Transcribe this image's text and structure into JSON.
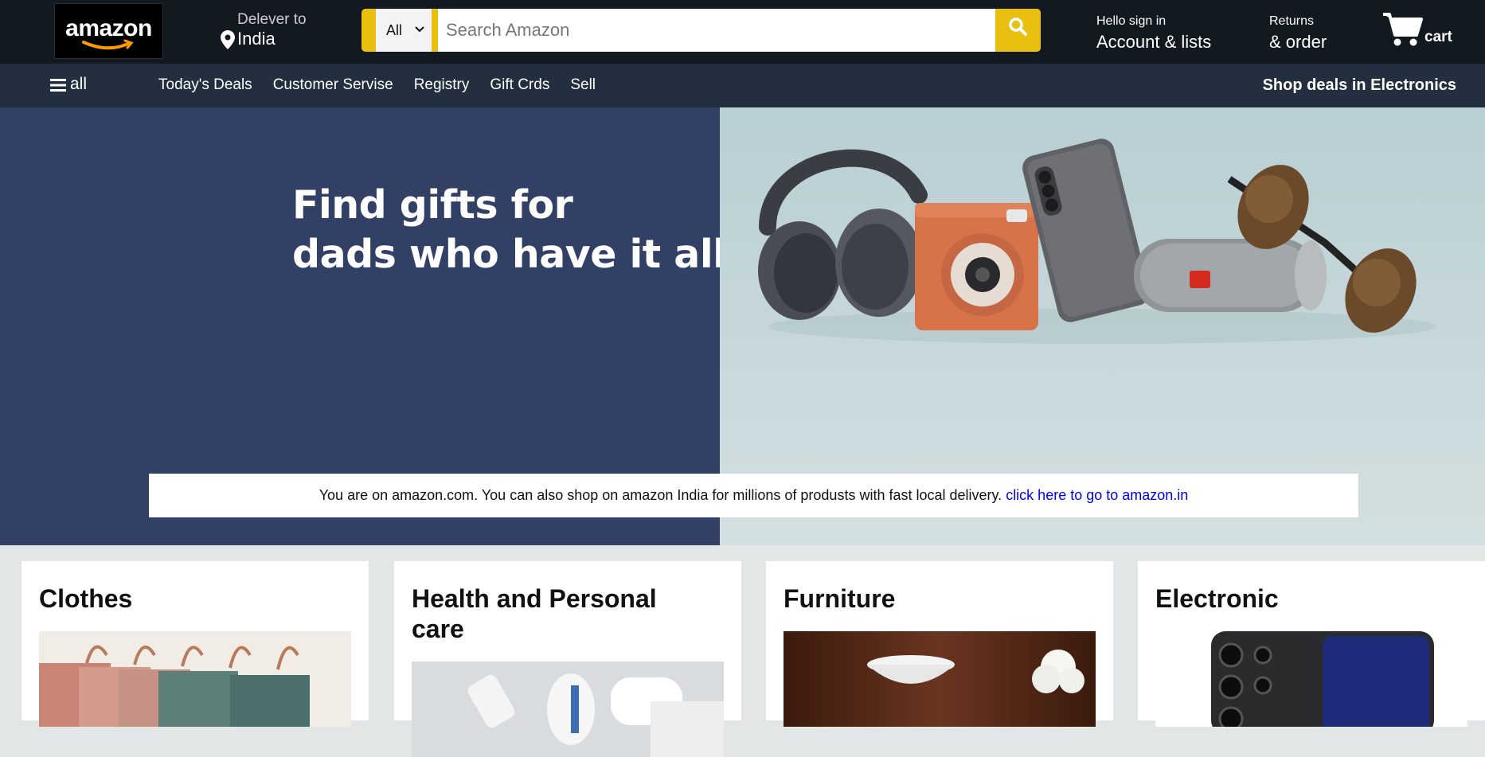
{
  "header": {
    "logo_text": "amazon",
    "deliver_label": "Delever to",
    "deliver_location": "India",
    "search": {
      "category": "All",
      "placeholder": "Search Amazon"
    },
    "account": {
      "line1": "Hello sign in",
      "line2": "Account & lists"
    },
    "returns": {
      "line1": "Returns",
      "line2": "& order"
    },
    "cart_label": "cart"
  },
  "subnav": {
    "all_label": "all",
    "links": [
      "Today's Deals",
      "Customer Servise",
      "Registry",
      "Gift Crds",
      "Sell"
    ],
    "promo": "Shop deals in Electronics"
  },
  "hero": {
    "title_line1": "Find gifts for",
    "title_line2": "dads who have it all",
    "left_color": "#334066",
    "right_color": "#c3d6d9"
  },
  "notice": {
    "text": "You are on amazon.com. You can also shop on amazon India for millions of produsts with fast local delivery. ",
    "link": "click here to go to amazon.in"
  },
  "cards": [
    {
      "title": "Clothes"
    },
    {
      "title": "Health and Personal care"
    },
    {
      "title": "Furniture"
    },
    {
      "title": "Electronic"
    }
  ],
  "colors": {
    "topnav": "#131921",
    "subnav": "#232f3e",
    "search_accent": "#e9bf10",
    "link": "#0000ee",
    "page_bg": "#e3e6e6"
  }
}
